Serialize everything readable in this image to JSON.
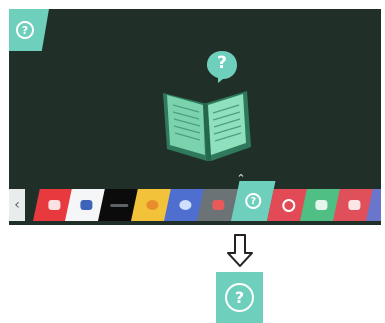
{
  "screen": {
    "background": "#203029",
    "accent": "#6fcfbd",
    "corner_tab": {
      "icon": "question-circle-icon",
      "glyph": "?"
    },
    "illustration": {
      "bubble_icon": "question-speech-bubble-icon",
      "bubble_glyph": "?",
      "book_icon": "open-book-icon"
    },
    "selection_caret": "⌃"
  },
  "launcher": {
    "left_arrow": "‹",
    "tiles": [
      {
        "name": "app-red",
        "color": "#e8393f",
        "mark": "rounded-square-icon"
      },
      {
        "name": "app-white-blue",
        "color": "#f4f6f8",
        "mark": "chat-cards-icon"
      },
      {
        "name": "app-black",
        "color": "#0b0b0b",
        "mark": "bar-icon"
      },
      {
        "name": "app-yellow",
        "color": "#f2c23a",
        "mark": "circle-icon"
      },
      {
        "name": "app-blue",
        "color": "#4f6fd0",
        "mark": "eye-icon"
      },
      {
        "name": "app-gray",
        "color": "#6b7377",
        "mark": "puzzle-icon"
      },
      {
        "name": "app-help",
        "color": "#6fcfbd",
        "mark": "question-circle-icon",
        "glyph": "?",
        "selected": true
      },
      {
        "name": "app-coral",
        "color": "#e24b55",
        "mark": "ring-icon"
      },
      {
        "name": "app-green",
        "color": "#4fbf84",
        "mark": "square-icon"
      },
      {
        "name": "app-pink",
        "color": "#e0505a",
        "mark": "tv-icon"
      },
      {
        "name": "app-indigo",
        "color": "#6a76cc",
        "mark": "square-icon"
      }
    ]
  },
  "transition_arrow": "down-arrow-icon",
  "result": {
    "icon": "question-circle-icon",
    "glyph": "?",
    "color": "#6fcfbd"
  }
}
